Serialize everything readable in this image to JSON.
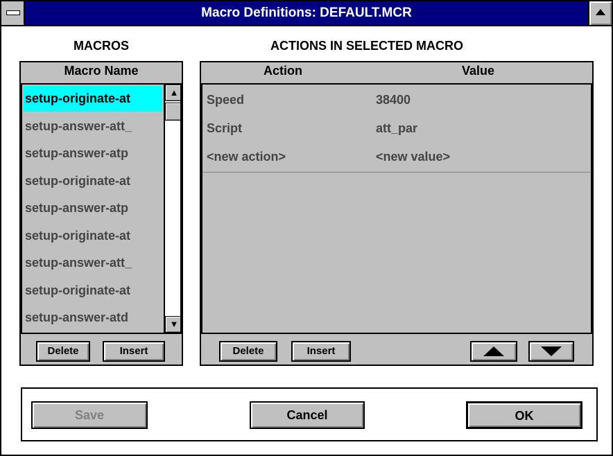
{
  "window": {
    "title": "Macro Definitions: DEFAULT.MCR"
  },
  "macros_section": {
    "label": "MACROS",
    "column_header": "Macro Name",
    "items": [
      "setup-originate-at",
      "setup-answer-att_",
      "setup-answer-atp",
      "setup-originate-at",
      "setup-answer-atp",
      "setup-originate-at",
      "setup-answer-att_",
      "setup-originate-at",
      "setup-answer-atd"
    ],
    "selected_index": 0,
    "delete_label": "Delete",
    "insert_label": "Insert"
  },
  "actions_section": {
    "label": "ACTIONS IN SELECTED MACRO",
    "column_action": "Action",
    "column_value": "Value",
    "rows": [
      {
        "action": "Speed",
        "value": "38400"
      },
      {
        "action": "Script",
        "value": "att_par"
      },
      {
        "action": "<new action>",
        "value": "<new value>"
      }
    ],
    "delete_label": "Delete",
    "insert_label": "Insert",
    "move_up_icon": "triangle-up",
    "move_down_icon": "triangle-down"
  },
  "footer": {
    "save_label": "Save",
    "cancel_label": "Cancel",
    "ok_label": "OK"
  },
  "colors": {
    "titlebar": "#000080",
    "selection": "#00ffff",
    "face": "#c0c0c0"
  }
}
